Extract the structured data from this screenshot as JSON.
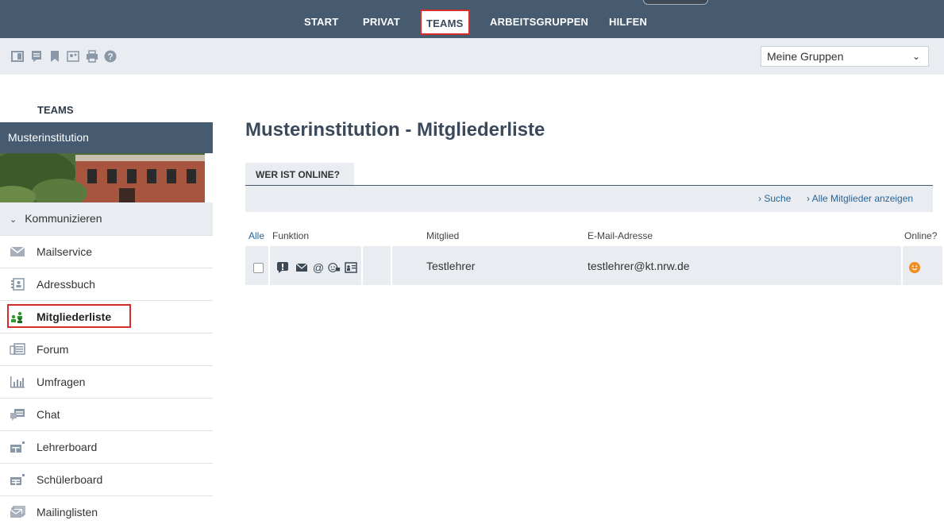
{
  "topnav": {
    "items": [
      {
        "label": "START"
      },
      {
        "label": "PRIVAT"
      },
      {
        "label": "TEAMS",
        "active": true
      },
      {
        "label": "ARBEITSGRUPPEN"
      },
      {
        "label": "HILFEN"
      }
    ]
  },
  "toolbar": {
    "icons": [
      "layout-icon",
      "note-icon",
      "bookmark-icon",
      "group-icon",
      "print-icon",
      "help-icon"
    ],
    "group_select": {
      "value": "Meine Gruppen"
    }
  },
  "sidebar": {
    "heading": "TEAMS",
    "institution": "Musterinstitution",
    "section": "Kommunizieren",
    "items": [
      {
        "label": "Mailservice",
        "icon": "envelope-icon"
      },
      {
        "label": "Adressbuch",
        "icon": "addressbook-icon"
      },
      {
        "label": "Mitgliederliste",
        "icon": "members-icon",
        "active": true
      },
      {
        "label": "Forum",
        "icon": "forum-icon"
      },
      {
        "label": "Umfragen",
        "icon": "poll-icon"
      },
      {
        "label": "Chat",
        "icon": "chat-icon"
      },
      {
        "label": "Lehrerboard",
        "icon": "board-icon"
      },
      {
        "label": "Schülerboard",
        "icon": "board-icon"
      },
      {
        "label": "Mailinglisten",
        "icon": "mailinglist-icon"
      }
    ]
  },
  "main": {
    "title": "Musterinstitution - Mitgliederliste",
    "tab": "WER IST ONLINE?",
    "links": {
      "search": "Suche",
      "show_all": "Alle Mitglieder anzeigen"
    },
    "columns": {
      "all": "Alle",
      "function": "Funktion",
      "member": "Mitglied",
      "email": "E-Mail-Adresse",
      "online": "Online?"
    },
    "rows": [
      {
        "member": "Testlehrer",
        "email": "testlehrer@kt.nrw.de",
        "online": true
      }
    ]
  },
  "colors": {
    "nav": "#465a70",
    "panel": "#e9edf2",
    "highlight": "#d42b2b",
    "online": "#f08c24"
  }
}
